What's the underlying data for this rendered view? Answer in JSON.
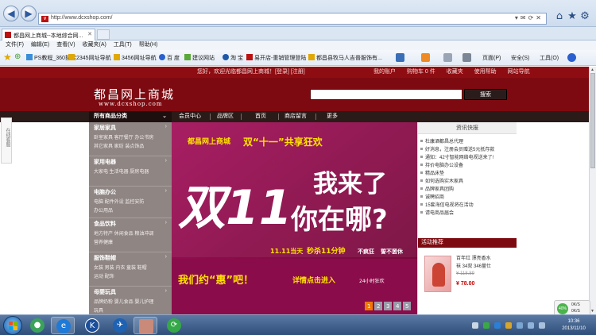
{
  "browser": {
    "url": "http://www.dcxshop.com/",
    "tab_title": "都昌网上商城--本地综合网...",
    "menu": [
      "文件(F)",
      "编辑(E)",
      "查看(V)",
      "收藏夹(A)",
      "工具(T)",
      "帮助(H)"
    ],
    "favorites": [
      "PS教程_360搜索",
      "2345网址导航",
      "3456网址导航",
      "百 度",
      "建议网站",
      "淘 宝",
      "易开店-重销管理登陆",
      "都昌县牧马人吉普服饰有..."
    ],
    "command_bar": [
      "页面(P)",
      "安全(S)",
      "工具(O)"
    ]
  },
  "site": {
    "welcome": "您好，欢迎光临都昌网上商城！[登录] [注册]",
    "top_links": [
      "我的账户",
      "购物车 0 件",
      "收藏夹",
      "使用帮助",
      "网站导航"
    ],
    "logo_title": "都昌网上商城",
    "logo_url": "www.dcxshop.com",
    "search_placeholder": "",
    "search_button": "搜索",
    "nav": {
      "category_title": "所有商品分类",
      "items": [
        "会员中心",
        "品牌区",
        "首页",
        "商店留言",
        "更多"
      ]
    },
    "side_float": "在线客服",
    "categories": [
      {
        "title": "家居家具",
        "lines": [
          "卧室家具  客厅餐厅  办公书房",
          "其它家具  家纺  装点饰品"
        ]
      },
      {
        "title": "家用电器",
        "lines": [
          "大家电  生活电器  厨房电器"
        ]
      },
      {
        "title": "电脑办公",
        "lines": [
          "电脑  配件外设  监控安防",
          "办公用品"
        ]
      },
      {
        "title": "食品饮料",
        "lines": [
          "地方特产  休闲食品  粮油冲调",
          "营养健康"
        ]
      },
      {
        "title": "服饰鞋帽",
        "lines": [
          "女装  男装  内衣  童装  鞋帽",
          "运动  配饰"
        ]
      },
      {
        "title": "母婴玩具",
        "lines": [
          "品牌奶粉  婴儿食品  婴儿护理",
          "玩具"
        ]
      }
    ],
    "banner": {
      "top_text": "都昌网上商城",
      "headline": "双“十一”共享狂欢",
      "big": "双11",
      "line1": "我来了",
      "line2": "你在哪?",
      "date": "11.11当天",
      "seckill": "秒杀11分钟",
      "tag1": "不疯狂",
      "tag2": "誓不罢休",
      "slogan": "我们约“惠”吧！",
      "cta": "详情点击进入",
      "hours": "24小时狂欢",
      "pages": [
        "1",
        "2",
        "3",
        "4",
        "5"
      ]
    },
    "news": {
      "title": "资讯快报",
      "items": [
        "杜康酒都昌总代理",
        "好消息，注册会员赠送5元抵存款",
        "通知：42寸智能网络电视送来了!",
        "持价电脑办公设备",
        "精品床垫",
        "如何选购实木家具",
        "品牌家具团购",
        "诚聘招商",
        "15套海信电视将在活动",
        "请电商品届会"
      ]
    },
    "promo": {
      "title": "活动推荐",
      "name_line1": "百年红 漂亮香水",
      "name_line2": "袜 34双 346量仕",
      "old_price": "¥ 118.89",
      "price": "¥ 78.00"
    }
  },
  "tray": {
    "percent": "40%",
    "up": "0K/S",
    "down": "0K/S",
    "time": "10:36",
    "date": "2013/11/10"
  },
  "colors": {
    "brand_red": "#7d0a10",
    "banner_magenta": "#8b0c4a"
  }
}
